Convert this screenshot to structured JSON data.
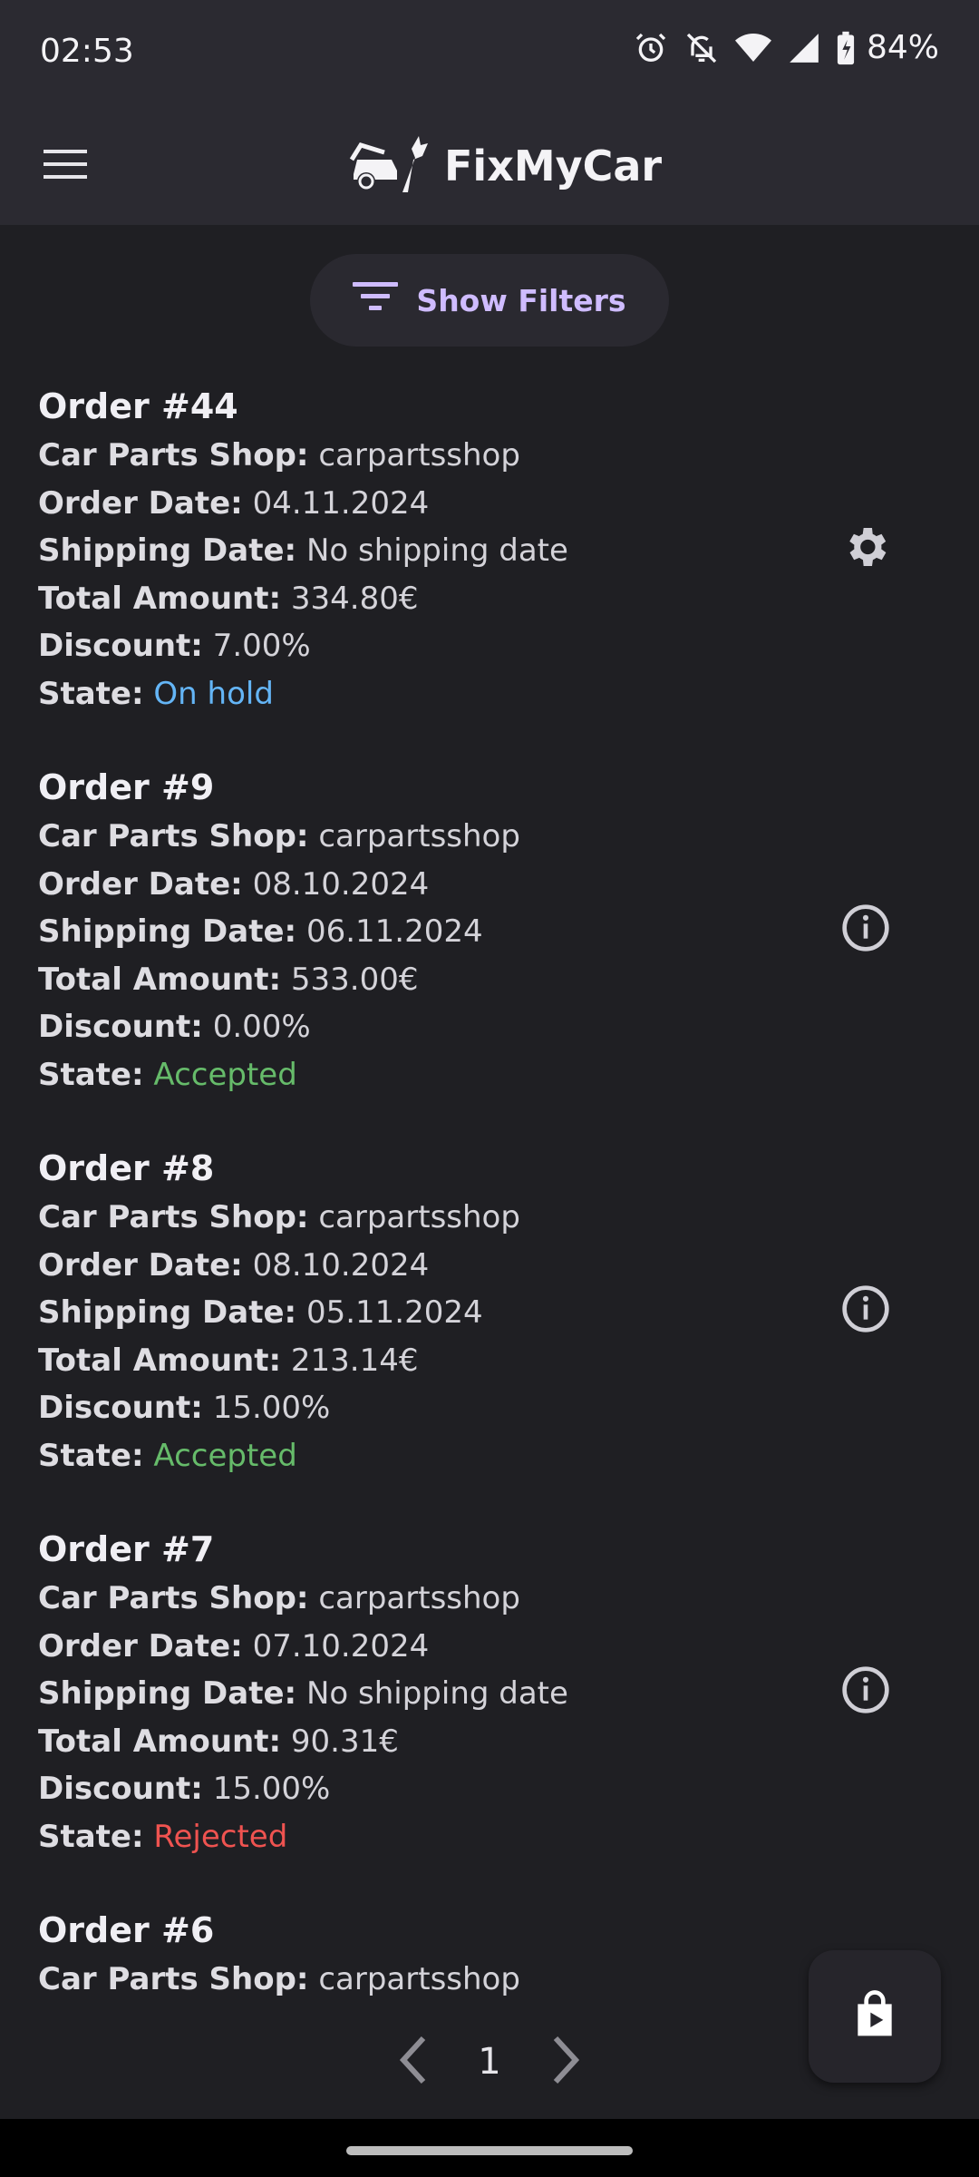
{
  "status_bar": {
    "time": "02:53",
    "battery": "84%",
    "icons": [
      "alarm-icon",
      "bell-off-icon",
      "wifi-icon",
      "signal-icon",
      "battery-charging-icon"
    ]
  },
  "app_bar": {
    "title": "FixMyCar",
    "menu_icon": "hamburger-menu-icon",
    "logo_icon": "car-wrench-logo-icon"
  },
  "filters": {
    "label": "Show Filters",
    "icon": "filter-list-icon"
  },
  "labels": {
    "shop": "Car Parts Shop:",
    "order_date": "Order Date:",
    "shipping_date": "Shipping Date:",
    "total": "Total Amount:",
    "discount": "Discount:",
    "state": "State:"
  },
  "orders": [
    {
      "title": "Order #44",
      "shop": "carpartsshop",
      "order_date": "04.11.2024",
      "shipping_date": "No shipping date",
      "total": "334.80€",
      "discount": "7.00%",
      "state": "On hold",
      "state_color": "#64b5f6",
      "action_icon": "gear-icon"
    },
    {
      "title": "Order #9",
      "shop": "carpartsshop",
      "order_date": "08.10.2024",
      "shipping_date": "06.11.2024",
      "total": "533.00€",
      "discount": "0.00%",
      "state": "Accepted",
      "state_color": "#66bb6a",
      "action_icon": "info-icon"
    },
    {
      "title": "Order #8",
      "shop": "carpartsshop",
      "order_date": "08.10.2024",
      "shipping_date": "05.11.2024",
      "total": "213.14€",
      "discount": "15.00%",
      "state": "Accepted",
      "state_color": "#66bb6a",
      "action_icon": "info-icon"
    },
    {
      "title": "Order #7",
      "shop": "carpartsshop",
      "order_date": "07.10.2024",
      "shipping_date": "No shipping date",
      "total": "90.31€",
      "discount": "15.00%",
      "state": "Rejected",
      "state_color": "#ef5350",
      "action_icon": "info-icon"
    },
    {
      "title": "Order #6",
      "shop": "carpartsshop"
    }
  ],
  "pagination": {
    "current_page": "1",
    "prev_icon": "chevron-left-icon",
    "next_icon": "chevron-right-icon"
  },
  "fab": {
    "icon": "shopping-bag-play-icon"
  },
  "colors": {
    "accent": "#cfbcff",
    "background": "#1f1f23",
    "app_bar": "#2b2a31"
  }
}
